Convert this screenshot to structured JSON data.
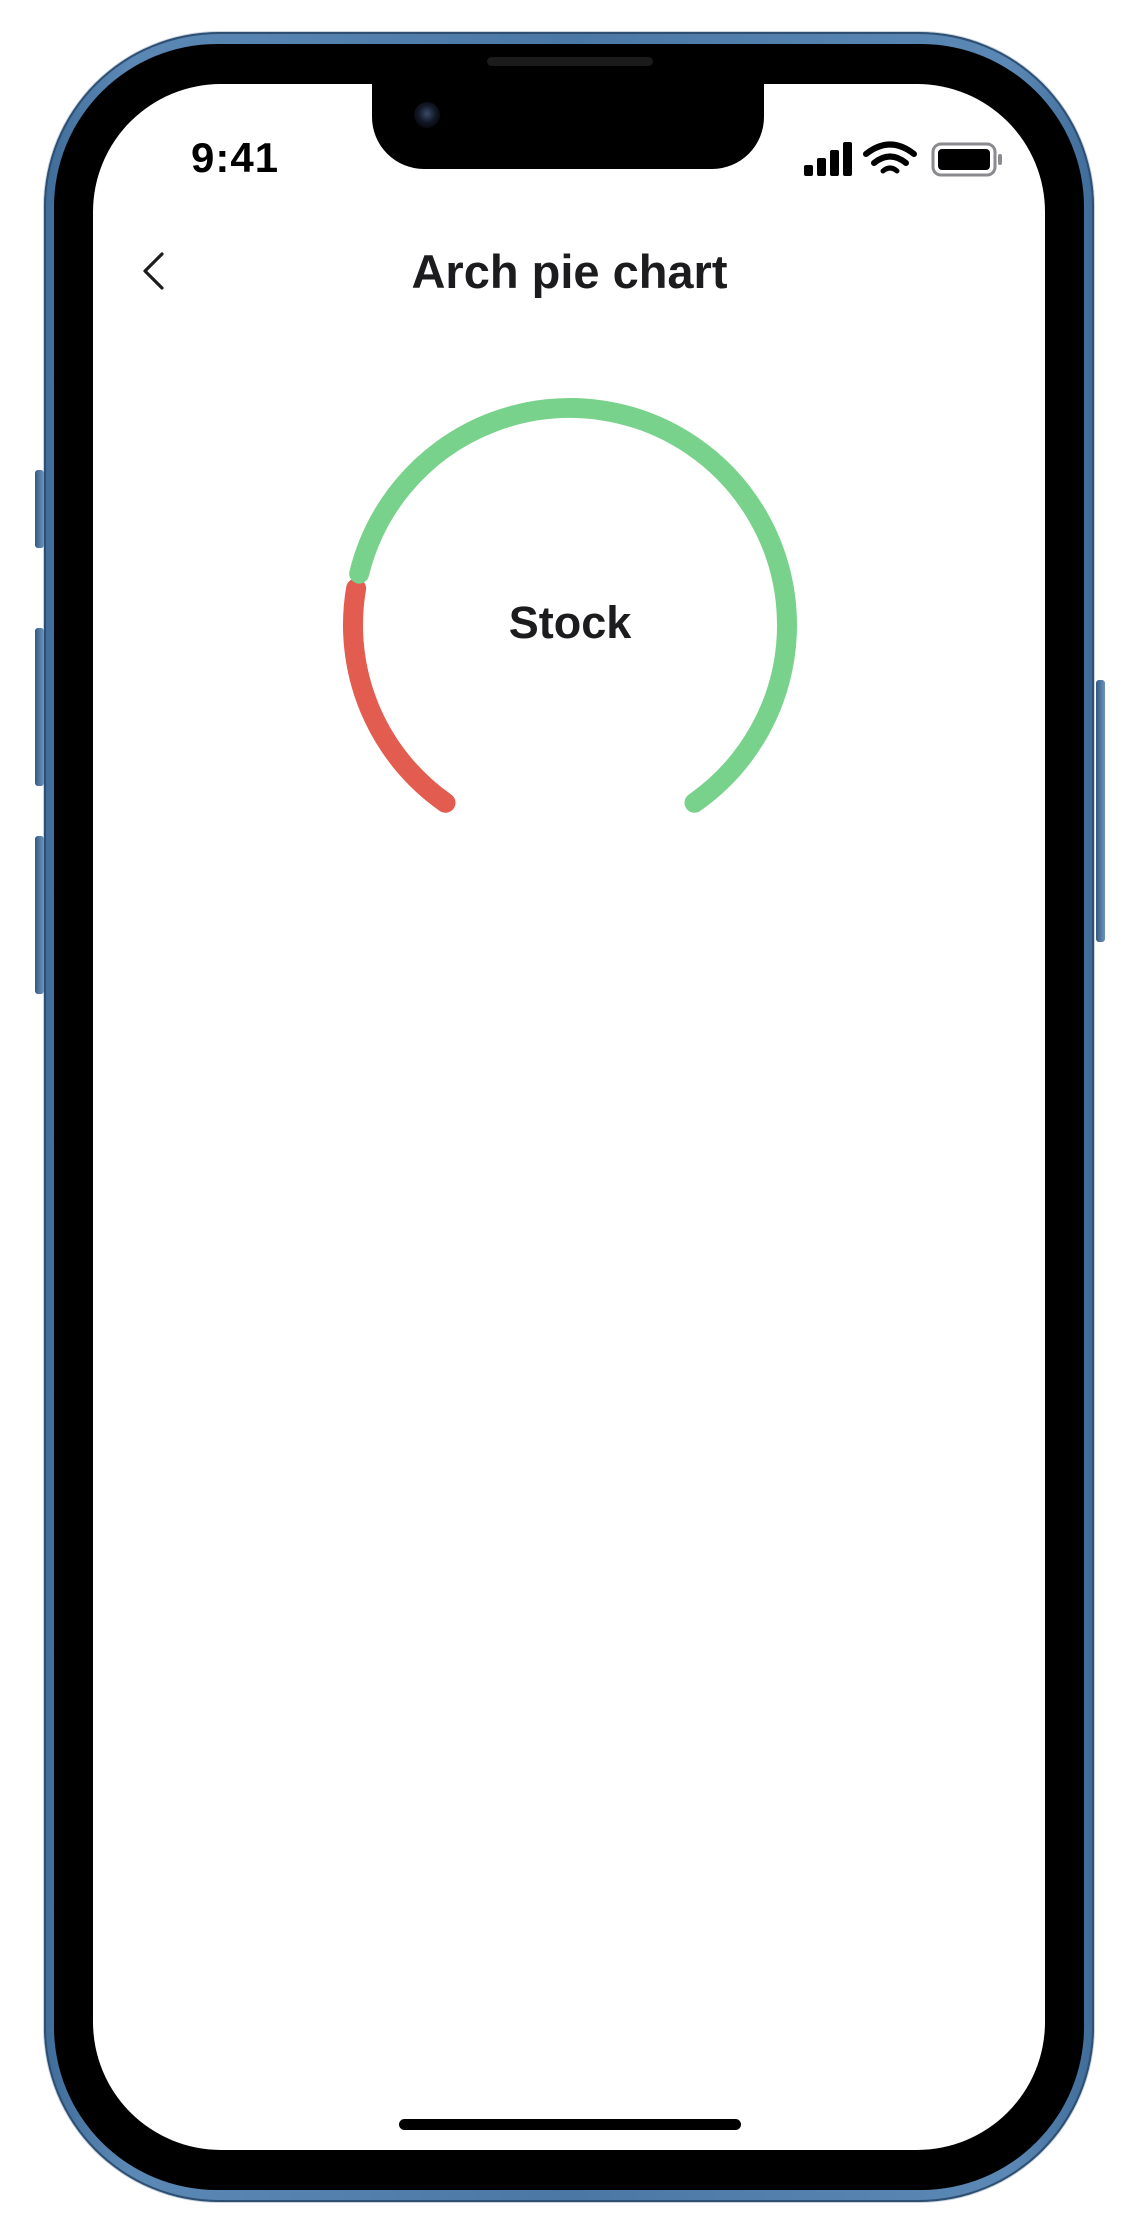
{
  "status_bar": {
    "time": "9:41",
    "icons": [
      "signal-icon",
      "wifi-icon",
      "battery-icon"
    ]
  },
  "nav": {
    "back_icon": "chevron-left-icon",
    "title": "Arch pie chart"
  },
  "colors": {
    "negative": "#e25c50",
    "positive": "#78d28c",
    "text": "#1c1c1e",
    "device_frame": "#4a77a4"
  },
  "chart_data": {
    "type": "pie",
    "variant": "arch",
    "center_label": "Stock",
    "slices": [
      {
        "value": 23,
        "color": "#e25c50"
      },
      {
        "value": 77,
        "color": "#78d28c"
      }
    ]
  }
}
